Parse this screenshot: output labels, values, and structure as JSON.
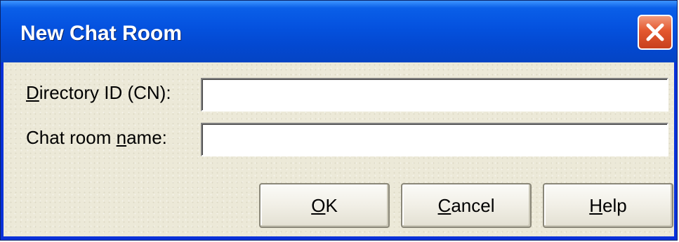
{
  "window": {
    "title": "New Chat Room"
  },
  "form": {
    "directory_id": {
      "label_accel": "D",
      "label_rest": "irectory ID (CN):",
      "value": "",
      "placeholder": ""
    },
    "chat_room_name": {
      "label_pre": "Chat room ",
      "label_accel": "n",
      "label_rest": "ame:",
      "value": "",
      "placeholder": ""
    }
  },
  "buttons": {
    "ok": {
      "accel": "O",
      "rest": "K"
    },
    "cancel": {
      "accel": "C",
      "rest": "ancel"
    },
    "help": {
      "accel": "H",
      "rest": "elp"
    }
  },
  "colors": {
    "titlebar": "#0553e0",
    "close_button": "#e4582f",
    "dialog_background": "#ece9d8"
  },
  "icons": {
    "close": "close-icon"
  }
}
